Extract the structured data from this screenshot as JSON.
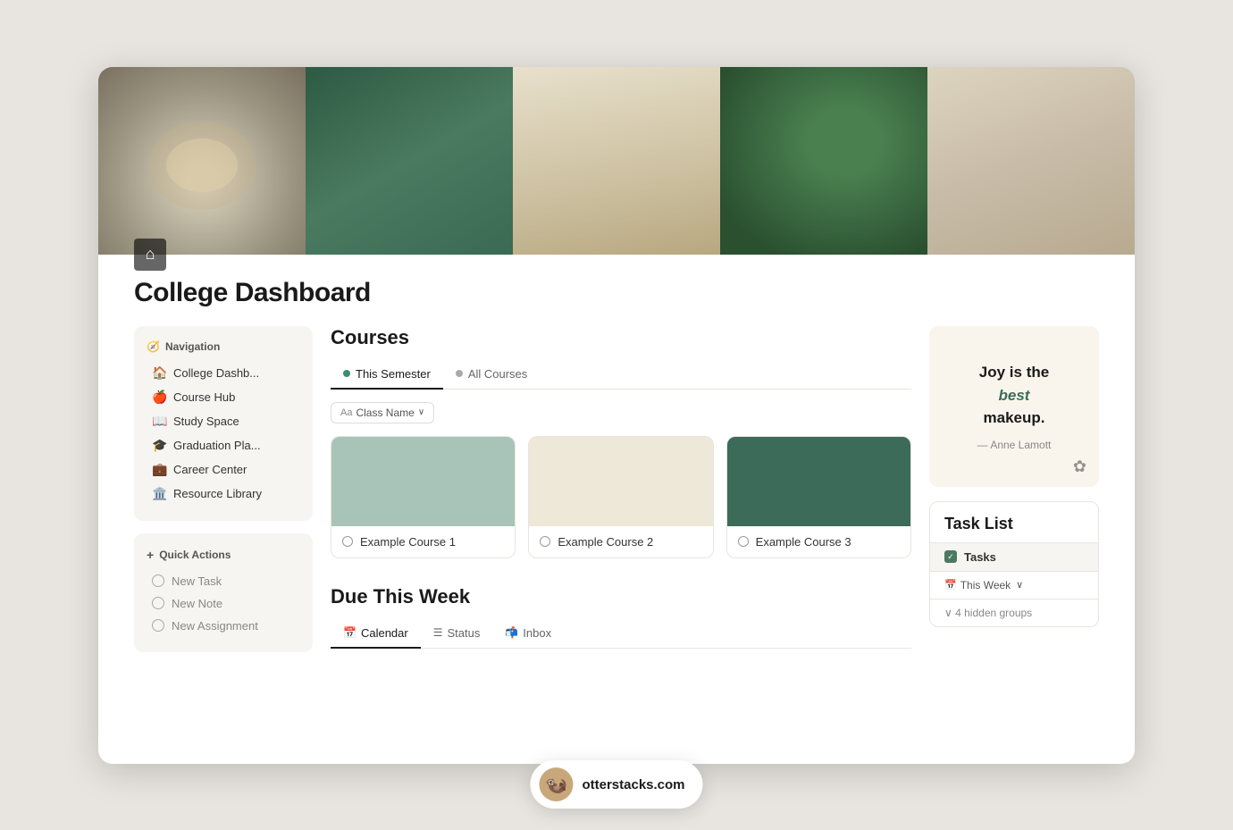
{
  "page": {
    "title": "College Dashboard"
  },
  "cover": {
    "images": [
      "cover-1",
      "cover-2",
      "cover-3",
      "cover-4",
      "cover-5"
    ]
  },
  "sidebar": {
    "nav_title": "Navigation",
    "nav_icon": "🧭",
    "items": [
      {
        "label": "College Dashb...",
        "icon": "🏠"
      },
      {
        "label": "Course Hub",
        "icon": "🍎"
      },
      {
        "label": "Study Space",
        "icon": "📖"
      },
      {
        "label": "Graduation Pla...",
        "icon": "🎓"
      },
      {
        "label": "Career Center",
        "icon": "💼"
      },
      {
        "label": "Resource Library",
        "icon": "🏛️"
      }
    ],
    "quick_actions_title": "Quick Actions",
    "quick_actions_plus": "+",
    "quick_actions": [
      {
        "label": "New Task"
      },
      {
        "label": "New Note"
      },
      {
        "label": "New Assignment"
      }
    ]
  },
  "courses": {
    "section_title": "Courses",
    "tabs": [
      {
        "label": "This Semester",
        "active": true
      },
      {
        "label": "All Courses",
        "active": false
      }
    ],
    "filter": {
      "label": "Class Name",
      "prefix": "Aa"
    },
    "cards": [
      {
        "title": "Example Course 1",
        "color": "sage"
      },
      {
        "title": "Example Course 2",
        "color": "cream"
      },
      {
        "title": "Example Course 3",
        "color": "forest"
      }
    ]
  },
  "due": {
    "section_title": "Due This Week",
    "tabs": [
      {
        "label": "Calendar",
        "icon": "📅",
        "active": true
      },
      {
        "label": "Status",
        "icon": "☰",
        "active": false
      },
      {
        "label": "Inbox",
        "icon": "📬",
        "active": false
      }
    ]
  },
  "quote": {
    "text_line1": "Joy is the",
    "text_line2": "best",
    "text_line3": "makeup.",
    "attribution": "— Anne Lamott",
    "decoration": "✿"
  },
  "task_list": {
    "title": "Task List",
    "tasks_label": "Tasks",
    "this_week_label": "This Week",
    "chevron": "∨",
    "hidden_groups": "∨  4 hidden groups"
  },
  "badge": {
    "site": "otterstacks.com",
    "emoji": "🦦"
  }
}
